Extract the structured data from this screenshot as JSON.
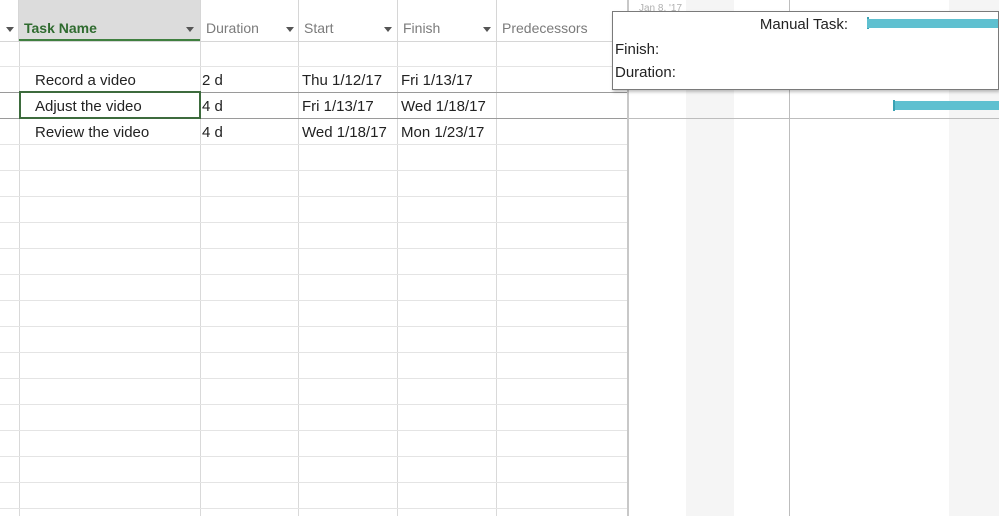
{
  "columns": {
    "task_name": "Task Name",
    "duration": "Duration",
    "start": "Start",
    "finish": "Finish",
    "predecessors": "Predecessors"
  },
  "tasks": [
    {
      "name": "Record a video",
      "duration": "2 d",
      "start": "Thu 1/12/17",
      "finish": "Fri 1/13/17",
      "predecessors": ""
    },
    {
      "name": "Adjust the video",
      "duration": "4 d",
      "start": "Fri 1/13/17",
      "finish": "Wed 1/18/17",
      "predecessors": ""
    },
    {
      "name": "Review the video",
      "duration": "4 d",
      "start": "Wed 1/18/17",
      "finish": "Mon 1/23/17",
      "predecessors": ""
    }
  ],
  "gantt": {
    "timescale_label": "Jan 8, '17"
  },
  "tooltip": {
    "title": "Manual Task:",
    "finish_label": "Finish:",
    "duration_label": "Duration:"
  },
  "colors": {
    "accent": "#3f7f3f",
    "bar": "#5fc0d0"
  }
}
